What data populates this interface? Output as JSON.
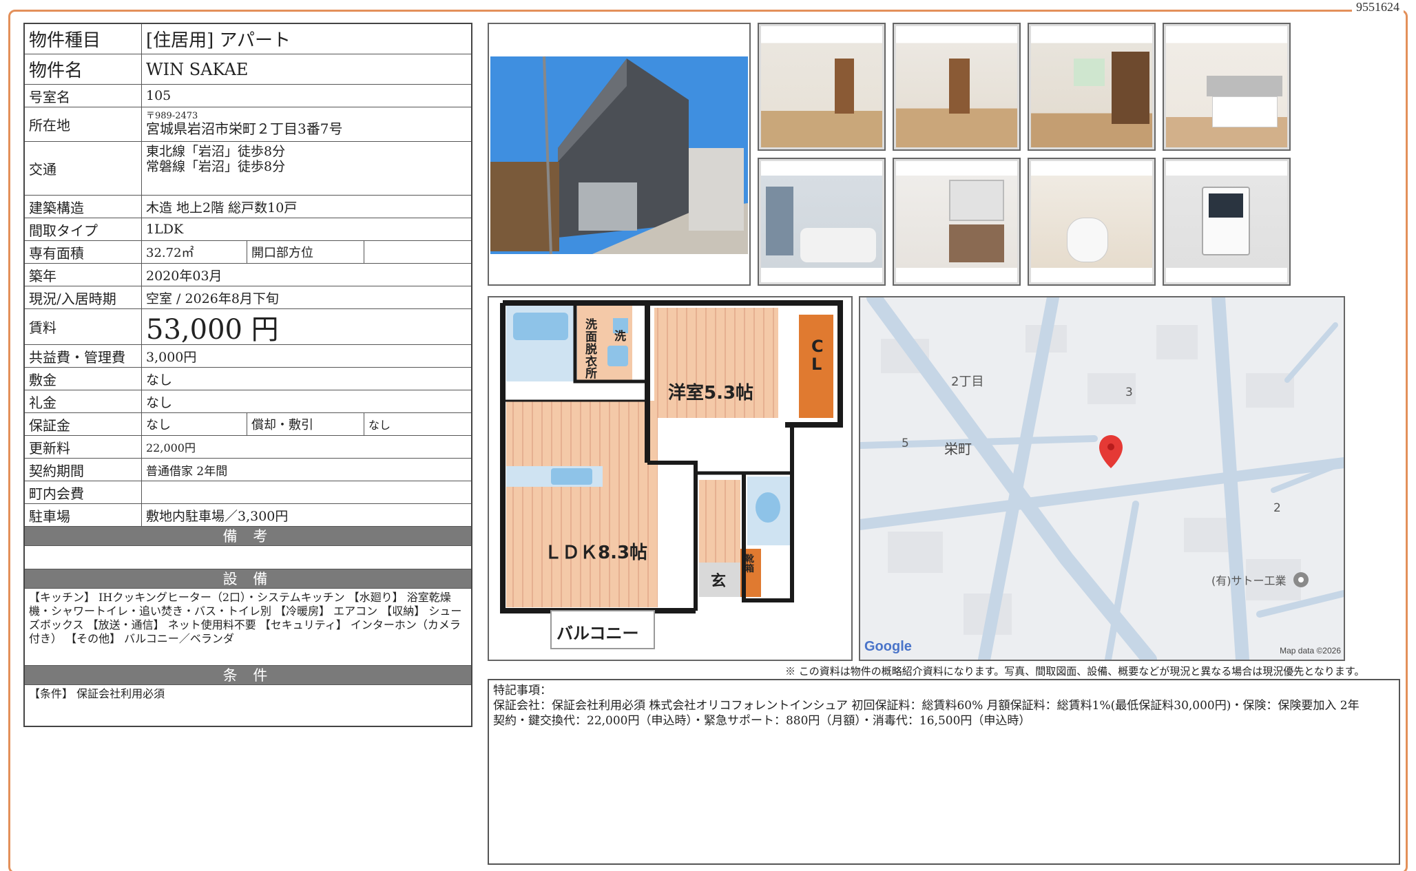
{
  "document_id": "9551624",
  "rows": {
    "type": {
      "label": "物件種目",
      "value": "[住居用]  アパート"
    },
    "name": {
      "label": "物件名",
      "value": "WIN SAKAE"
    },
    "room": {
      "label": "号室名",
      "value": "105"
    },
    "address": {
      "label": "所在地",
      "postal": "〒989-2473",
      "value": "宮城県岩沼市栄町２丁目3番7号"
    },
    "access": {
      "label": "交通",
      "line1": "東北線「岩沼」徒歩8分",
      "line2": "常磐線「岩沼」徒歩8分"
    },
    "structure": {
      "label": "建築構造",
      "value": "木造  地上2階  総戸数10戸"
    },
    "layout": {
      "label": "間取タイプ",
      "value": "1LDK"
    },
    "area": {
      "label": "専有面積",
      "value": "32.72㎡",
      "sub_label": "開口部方位",
      "sub_value": ""
    },
    "built": {
      "label": "築年",
      "value": "2020年03月"
    },
    "status": {
      "label": "現況/入居時期",
      "value": "空室  /  2026年8月下旬"
    },
    "rent": {
      "label": "賃料",
      "value": "53,000 円"
    },
    "fee": {
      "label": "共益費・管理費",
      "value": "3,000円"
    },
    "deposit": {
      "label": "敷金",
      "value": "なし"
    },
    "key_money": {
      "label": "礼金",
      "value": "なし"
    },
    "guarantee": {
      "label": "保証金",
      "value": "なし",
      "sub_label": "償却・敷引",
      "sub_value": "なし"
    },
    "renewal": {
      "label": "更新料",
      "value": "22,000円"
    },
    "contract": {
      "label": "契約期間",
      "value": "普通借家  2年間"
    },
    "community": {
      "label": "町内会費",
      "value": ""
    },
    "parking": {
      "label": "駐車場",
      "value": "敷地内駐車場／3,300円"
    }
  },
  "sections": {
    "remarks": {
      "title": "備 考",
      "text": ""
    },
    "equipment": {
      "title": "設 備",
      "text": "【キッチン】 IHクッキングヒーター（2口）・システムキッチン 【水廻り】 浴室乾燥機・シャワートイレ・追い焚き・バス・トイレ別 【冷暖房】 エアコン 【収納】 シューズボックス 【放送・通信】 ネット使用料不要 【セキュリティ】 インターホン（カメラ付き） 【その他】 バルコニー／ベランダ"
    },
    "conditions": {
      "title": "条 件",
      "text": "【条件】 保証会社利用必須"
    }
  },
  "floorplan": {
    "rooms": {
      "western": "洋室5.3帖",
      "ldk": "ＬＤＫ8.3帖",
      "balcony": "バルコニー",
      "entrance": "玄",
      "shoe": "靴箱",
      "closet": "CL",
      "washroom": "洗面脱衣所",
      "washer": "洗"
    }
  },
  "map": {
    "labels": {
      "chome": "2丁目",
      "n3": "3",
      "n5": "5",
      "town": "栄町",
      "n2": "2",
      "company": "(有)サトー工業",
      "google": "Google",
      "mapdata": "Map data ©2026"
    }
  },
  "disclaimer": "※  この資料は物件の概略紹介資料になります。写真、間取図面、設備、概要などが現況と異なる場合は現況優先となります。",
  "special": {
    "title": "特記事項：",
    "line1": "保証会社：保証会社利用必須  株式会社オリコフォレントインシュア  初回保証料：総賃料60%  月額保証料：総賃料1%(最低保証料30,000円)・保険：保険要加入  2年",
    "line2": "契約・鍵交換代：22,000円（申込時）・緊急サポート：880円（月額）・消毒代：16,500円（申込時）"
  }
}
